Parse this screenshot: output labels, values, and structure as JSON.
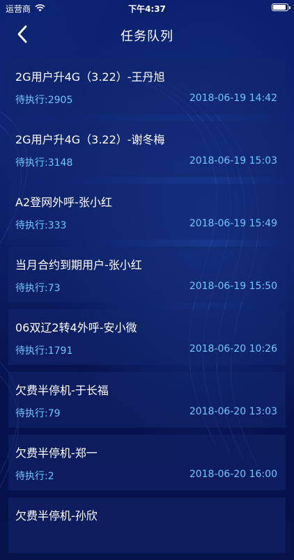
{
  "status_bar": {
    "carrier": "运营商",
    "time": "下午4:37"
  },
  "nav": {
    "title": "任务队列"
  },
  "tasks": [
    {
      "title": "2G用户升4G（3.22）-王丹旭",
      "pending": "待执行:2905",
      "time": "2018-06-19 14:42"
    },
    {
      "title": "2G用户升4G（3.22）-谢冬梅",
      "pending": "待执行:3148",
      "time": "2018-06-19 15:03"
    },
    {
      "title": "A2登网外呼-张小红",
      "pending": "待执行:333",
      "time": "2018-06-19 15:49"
    },
    {
      "title": "当月合约到期用户-张小红",
      "pending": "待执行:73",
      "time": "2018-06-19 15:50"
    },
    {
      "title": "06双辽2转4外呼-安小微",
      "pending": "待执行:1791",
      "time": "2018-06-20 10:26"
    },
    {
      "title": "欠费半停机-于长福",
      "pending": "待执行:79",
      "time": "2018-06-20 13:03"
    },
    {
      "title": "欠费半停机-郑一",
      "pending": "待执行:2",
      "time": "2018-06-20 16:00"
    },
    {
      "title": "欠费半停机-孙欣",
      "pending": "",
      "time": ""
    }
  ],
  "colors": {
    "background": "#07134a",
    "card": "#12266e",
    "accent": "#6fc7ff",
    "text": "#ffffff"
  }
}
